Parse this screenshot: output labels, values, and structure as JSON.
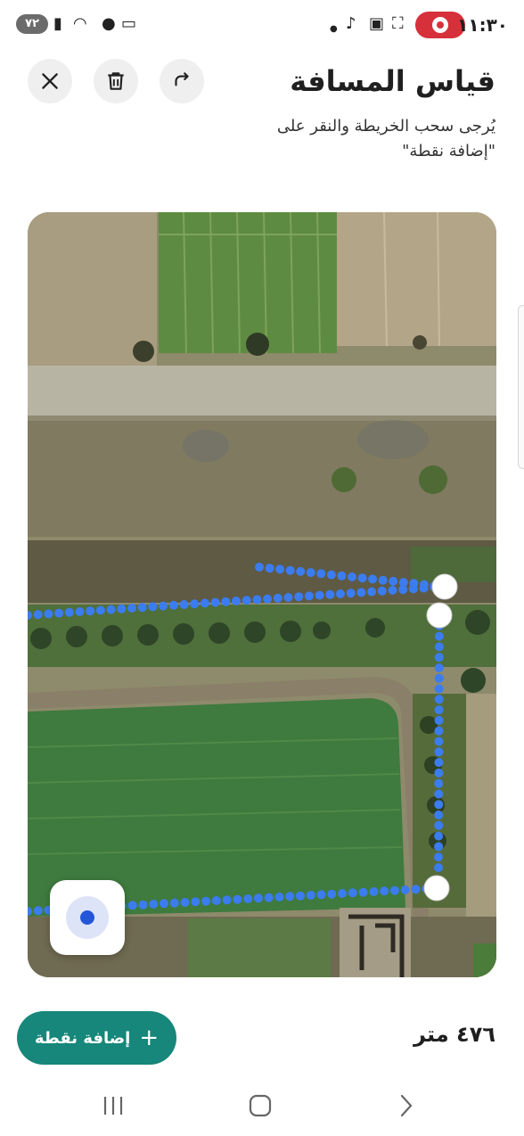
{
  "status_bar": {
    "time": "١١:٣٠",
    "battery": "٧٢",
    "left_icons": [
      "battery-icon",
      "signal-icon",
      "wifi-icon",
      "location-icon",
      "cast-icon"
    ],
    "right_icons": [
      "recording-icon",
      "screenshot-icon",
      "app-icon",
      "tiktok-icon",
      "dot-icon"
    ]
  },
  "header": {
    "title": "قياس المسافة",
    "subtitle": "يُرجى سحب الخريطة والنقر على \"إضافة نقطة\""
  },
  "toolbar": {
    "close_icon": "close-icon",
    "delete_icon": "trash-icon",
    "redo_icon": "redo-icon"
  },
  "map": {
    "route_color": "#3b7cf0",
    "point_color": "#ffffff",
    "points": 4
  },
  "footer": {
    "add_point_label": "إضافة نقطة",
    "distance": "٤٧٦ متر"
  },
  "colors": {
    "accent": "#16877a",
    "record": "#d6313a"
  }
}
